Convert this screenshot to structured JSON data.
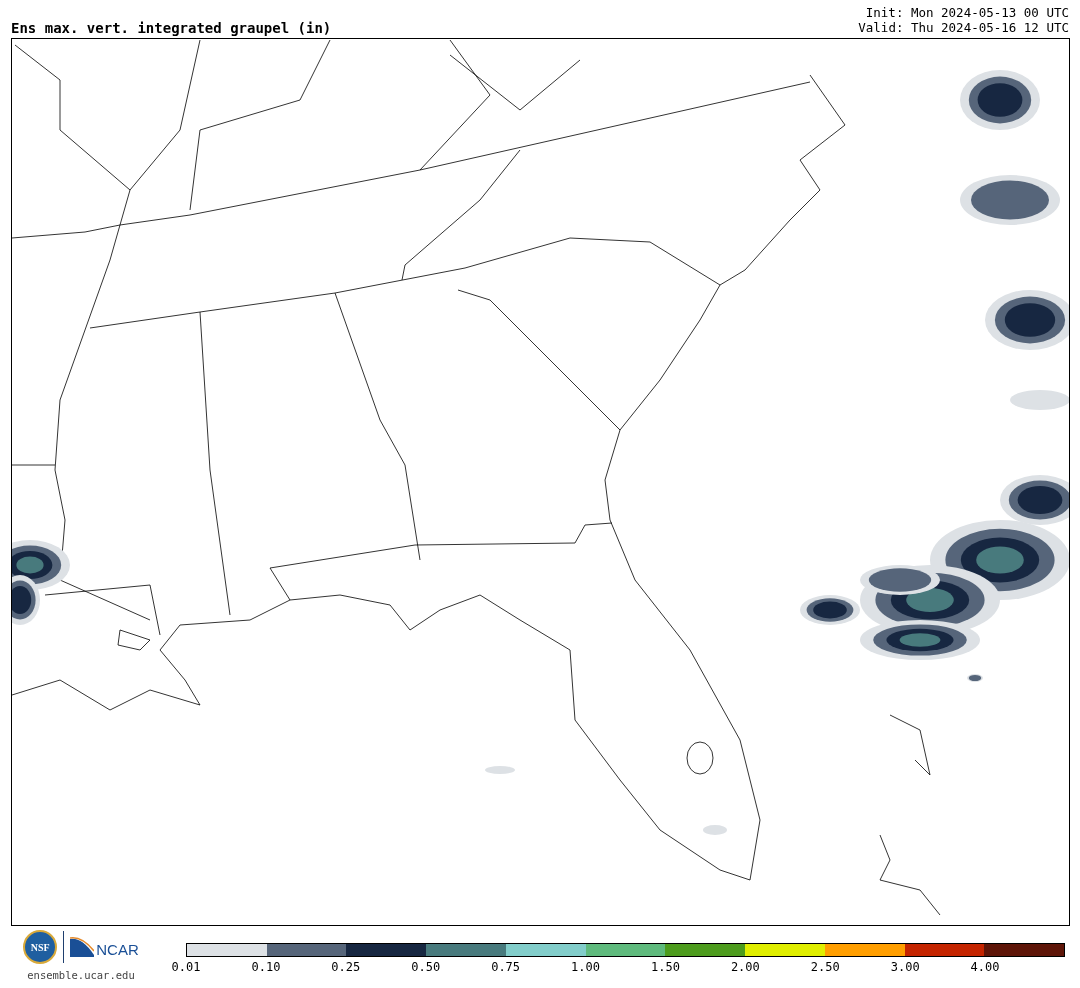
{
  "title": "Ens max. vert. integrated graupel (in)",
  "init": "Init: Mon 2024-05-13 00 UTC",
  "valid": "Valid: Thu 2024-05-16 12 UTC",
  "logos": {
    "nsf": "NSF",
    "ncar": "NCAR"
  },
  "site": "ensemble.ucar.edu",
  "colorbar": [
    {
      "label": "0.01",
      "color": "#dde1e5"
    },
    {
      "label": "0.10",
      "color": "#56657a"
    },
    {
      "label": "0.25",
      "color": "#172741"
    },
    {
      "label": "0.50",
      "color": "#487a7d"
    },
    {
      "label": "0.75",
      "color": "#82cdca"
    },
    {
      "label": "1.00",
      "color": "#5fba7d"
    },
    {
      "label": "1.50",
      "color": "#4d9c1d"
    },
    {
      "label": "2.00",
      "color": "#e0ee00"
    },
    {
      "label": "2.50",
      "color": "#ff9e00"
    },
    {
      "label": "3.00",
      "color": "#c42400"
    },
    {
      "label": "4.00",
      "color": "#5e1508"
    }
  ]
}
